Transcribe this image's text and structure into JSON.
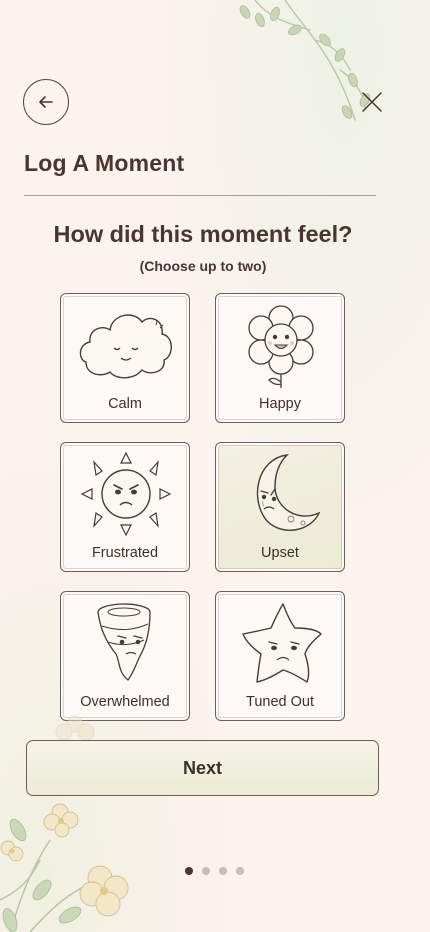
{
  "header": {
    "back_icon": "arrow-left-icon",
    "close_icon": "close-icon",
    "title": "Log A Moment"
  },
  "prompt": {
    "question": "How did this moment feel?",
    "hint": "(Choose up to two)"
  },
  "moods": [
    {
      "label": "Calm",
      "icon": "cloud-face-icon",
      "selected": false
    },
    {
      "label": "Happy",
      "icon": "flower-face-icon",
      "selected": false
    },
    {
      "label": "Frustrated",
      "icon": "angry-sun-icon",
      "selected": false
    },
    {
      "label": "Upset",
      "icon": "sad-moon-icon",
      "selected": true
    },
    {
      "label": "Overwhelmed",
      "icon": "tornado-face-icon",
      "selected": false
    },
    {
      "label": "Tuned Out",
      "icon": "sad-star-icon",
      "selected": false
    }
  ],
  "actions": {
    "next_label": "Next"
  },
  "pagination": {
    "total": 4,
    "current": 1
  },
  "colors": {
    "background": "#fbf3ee",
    "text": "#4a3530",
    "selected_card": "#ecebd3",
    "border": "#6e5d58"
  }
}
